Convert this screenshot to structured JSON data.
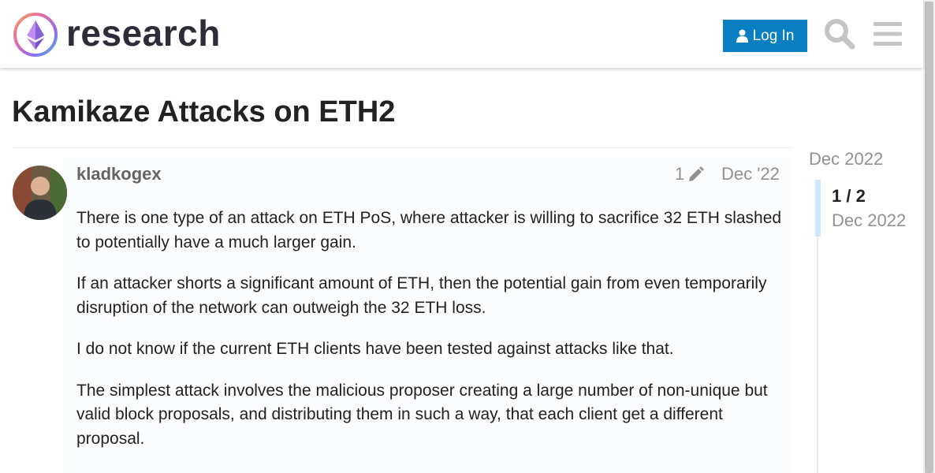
{
  "header": {
    "site_name": "research",
    "login_label": "Log In",
    "icons": [
      "ethereum-logo",
      "user-icon",
      "search-icon",
      "menu-icon"
    ]
  },
  "topic": {
    "title": "Kamikaze Attacks on ETH2"
  },
  "post": {
    "username": "kladkogex",
    "edit_count": "1",
    "date": "Dec '22",
    "paragraphs": [
      "There is one type of an attack on ETH PoS, where attacker is willing to sacrifice 32 ETH slashed to potentially have a much larger gain.",
      "If an attacker shorts a significant amount of ETH, then the potential gain from even temporarily disruption of the network can outweigh the 32 ETH loss.",
      "I do not know if the current ETH clients have been tested against attacks like that.",
      "The simplest attack involves the malicious proposer creating a large number of non-unique but valid block proposals, and distributing them in such a way, that each client get a different proposal."
    ]
  },
  "timeline": {
    "start_date": "Dec 2022",
    "position": "1 / 2",
    "current_date": "Dec 2022"
  },
  "colors": {
    "accent": "#0a7ec2",
    "text": "#222222",
    "muted": "#919191",
    "timeline_handle": "#cce7fa"
  }
}
